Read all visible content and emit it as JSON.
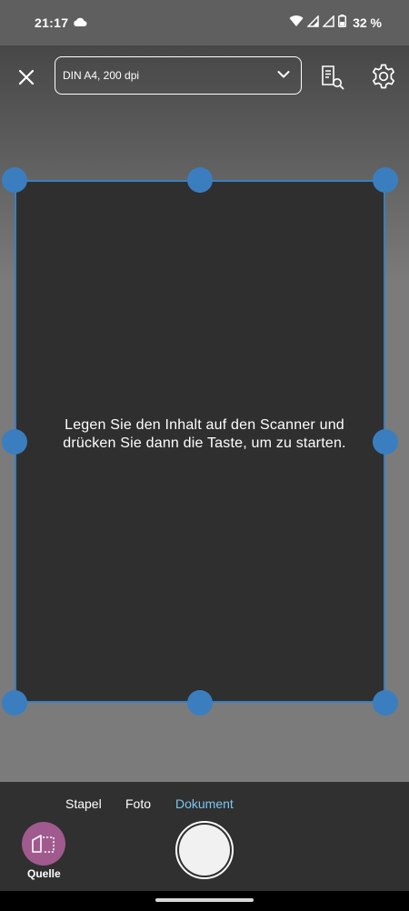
{
  "status_bar": {
    "time": "21:17",
    "battery": "32 %",
    "icons": [
      "cloud-icon",
      "wifi-icon",
      "signal-icon",
      "signal-icon",
      "battery-icon"
    ]
  },
  "toolbar": {
    "preset_value": "DIN A4, 200 dpi",
    "icons": [
      "close-icon",
      "chevron-down-icon",
      "document-search-icon",
      "gear-icon"
    ]
  },
  "scan_area": {
    "hint": "Legen Sie den Inhalt auf den Scanner und drücken Sie dann die Taste, um zu starten.",
    "accent_color": "#3a7ebf"
  },
  "modes": {
    "stack": "Stapel",
    "photo": "Foto",
    "document": "Dokument",
    "active": "Dokument",
    "active_color": "#7cc6f0"
  },
  "source": {
    "label": "Quelle",
    "color": "#a05a8e"
  }
}
